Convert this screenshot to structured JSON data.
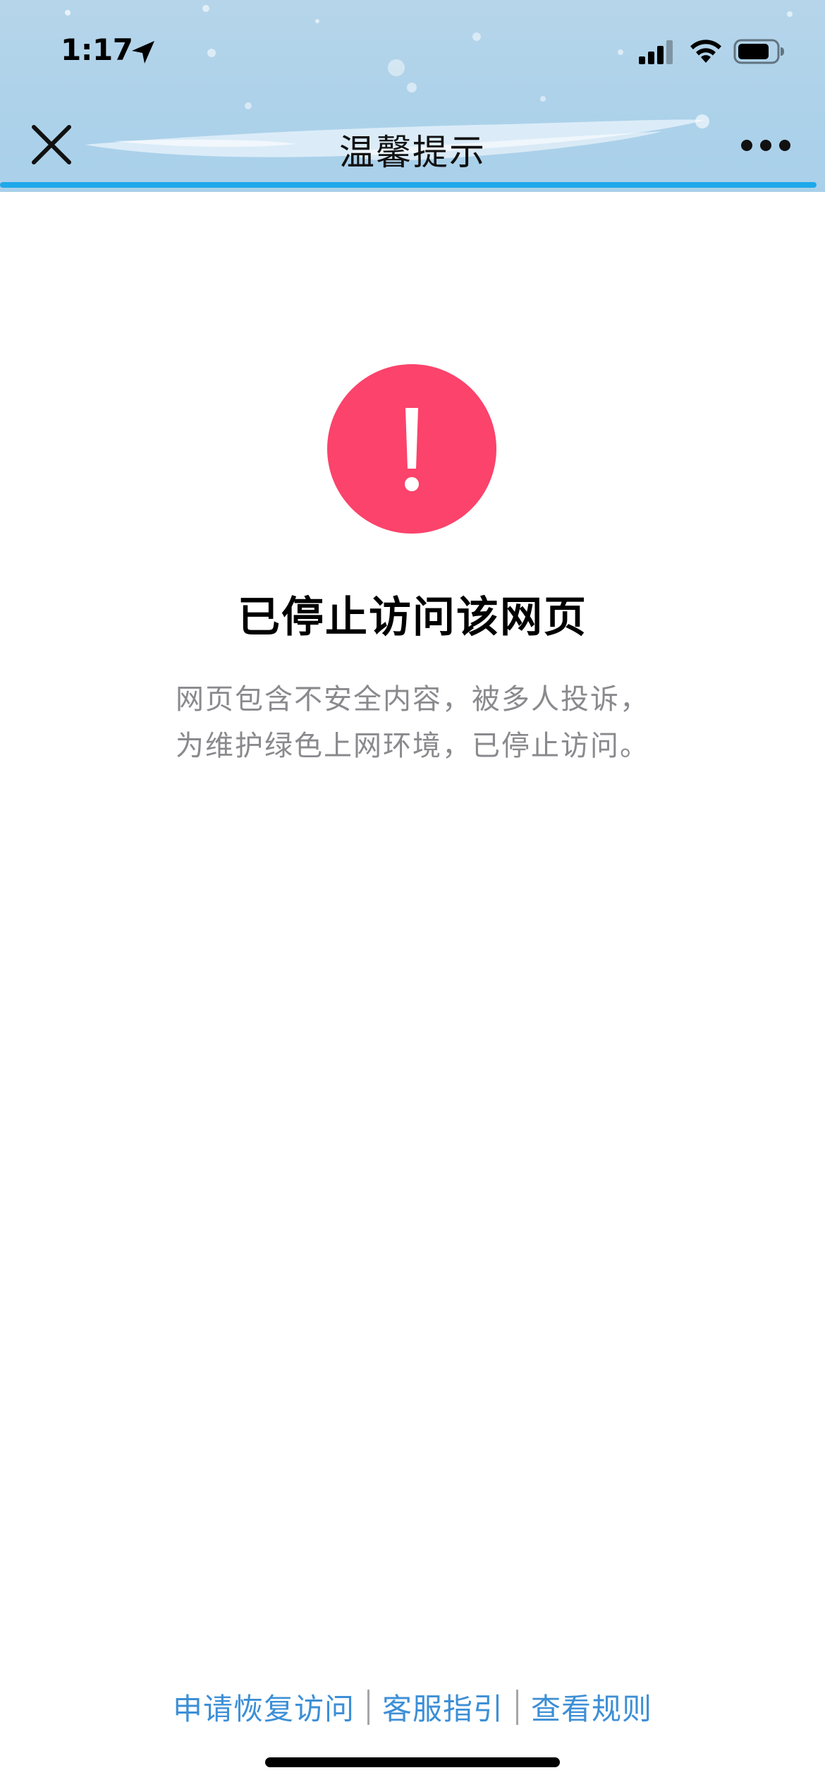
{
  "status_bar": {
    "time": "1:17",
    "location_icon": "location-arrow-icon",
    "signal_icon": "cellular-signal-icon",
    "wifi_icon": "wifi-icon",
    "battery_icon": "battery-icon"
  },
  "nav": {
    "title": "温馨提示",
    "close_icon": "close-icon",
    "more_icon": "more-dots-icon",
    "load_progress": 0.99
  },
  "alert": {
    "icon": "exclamation-icon",
    "icon_color": "#fb436b",
    "title": "已停止访问该网页",
    "desc_line1": "网页包含不安全内容，被多人投诉，",
    "desc_line2": "为维护绿色上网环境，已停止访问。"
  },
  "footer": {
    "link1": "申请恢复访问",
    "link2": "客服指引",
    "link3": "查看规则",
    "link_color": "#3d8fd6"
  },
  "colors": {
    "header_bg": "#add2ea",
    "progress": "#1ea8ea",
    "desc_text": "#8a8a8e"
  }
}
